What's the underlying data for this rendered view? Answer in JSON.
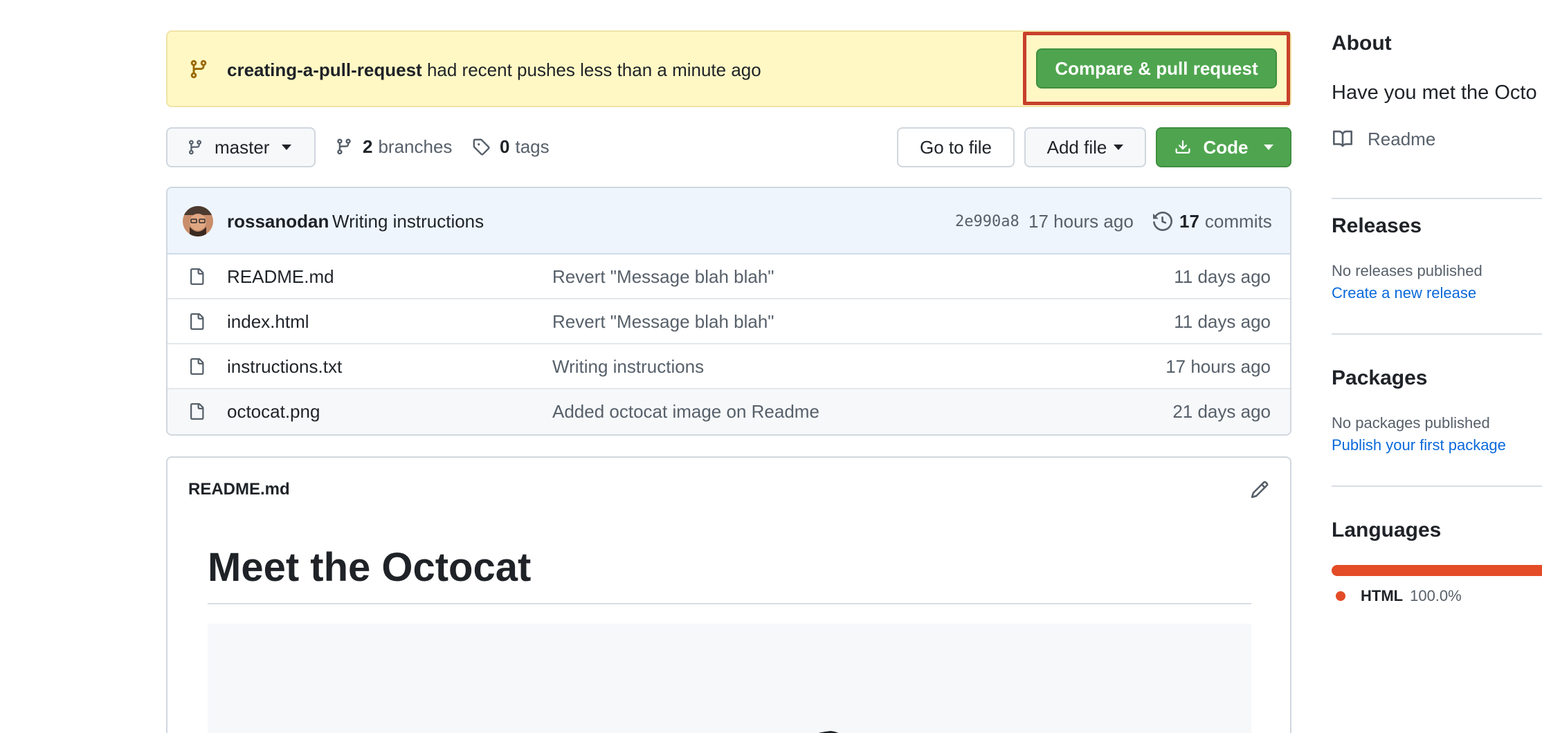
{
  "banner": {
    "branch_name": "creating-a-pull-request",
    "message": "had recent pushes less than a minute ago",
    "compare_button": "Compare & pull request"
  },
  "toolbar": {
    "branch": "master",
    "branches_count": "2",
    "branches_label": "branches",
    "tags_count": "0",
    "tags_label": "tags",
    "go_to_file": "Go to file",
    "add_file": "Add file",
    "code": "Code"
  },
  "latest_commit": {
    "author": "rossanodan",
    "message": "Writing instructions",
    "sha": "2e990a8",
    "time": "17 hours ago",
    "commits_count": "17",
    "commits_label": "commits"
  },
  "files": [
    {
      "name": "README.md",
      "message": "Revert \"Message blah blah\"",
      "age": "11 days ago"
    },
    {
      "name": "index.html",
      "message": "Revert \"Message blah blah\"",
      "age": "11 days ago"
    },
    {
      "name": "instructions.txt",
      "message": "Writing instructions",
      "age": "17 hours ago"
    },
    {
      "name": "octocat.png",
      "message": "Added octocat image on Readme",
      "age": "21 days ago"
    }
  ],
  "readme": {
    "filename": "README.md",
    "heading": "Meet the Octocat"
  },
  "sidebar": {
    "about_title": "About",
    "about_description": "Have you met the Octo",
    "readme_link": "Readme",
    "releases_title": "Releases",
    "releases_note": "No releases published",
    "releases_link": "Create a new release",
    "packages_title": "Packages",
    "packages_note": "No packages published",
    "packages_link": "Publish your first package",
    "languages_title": "Languages",
    "languages": [
      {
        "name": "HTML",
        "percent": "100.0%",
        "color": "#e34c26"
      }
    ]
  },
  "colors": {
    "banner_bg": "#fff8c5",
    "primary_green": "#4fa54f",
    "highlight_red": "#c8402a",
    "link_blue": "#0969da"
  },
  "icons": [
    "git-branch-icon",
    "tag-icon",
    "download-icon",
    "history-icon",
    "file-icon",
    "pencil-icon",
    "book-icon"
  ]
}
